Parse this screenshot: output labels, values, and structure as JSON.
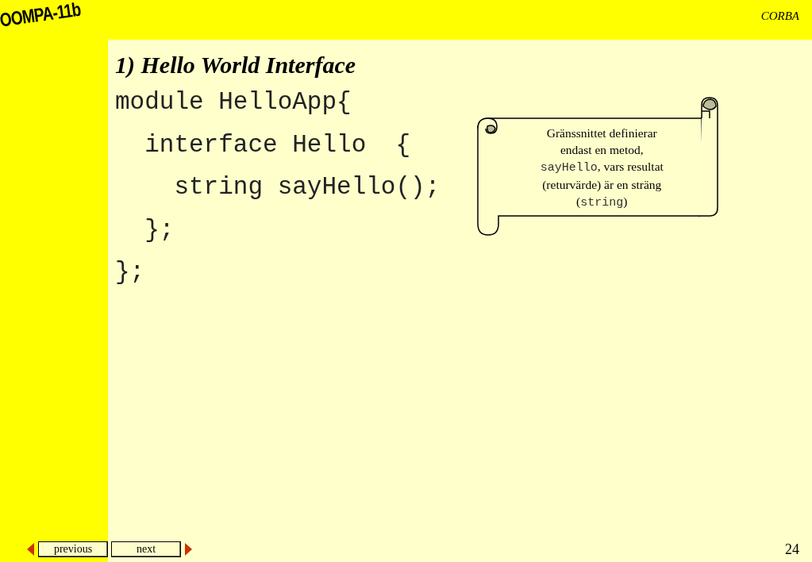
{
  "logo": "OOMPA-11b",
  "header": {
    "title": "CORBA"
  },
  "slide": {
    "title": "1) Hello World Interface",
    "code_lines": [
      "module HelloApp{",
      "  interface Hello  {",
      "    string sayHello();",
      "  };",
      "};"
    ],
    "callout": [
      {
        "kind": "text",
        "text": "Gränssnittet definierar endast en metod, "
      },
      {
        "kind": "code",
        "text": "sayHello"
      },
      {
        "kind": "text",
        "text": ", vars resultat (returvärde) är en sträng ("
      },
      {
        "kind": "code",
        "text": "string"
      },
      {
        "kind": "text",
        "text": ")"
      }
    ]
  },
  "nav": {
    "buttons": [
      {
        "label": "previous"
      },
      {
        "label": "next"
      }
    ],
    "page_number": "24"
  }
}
